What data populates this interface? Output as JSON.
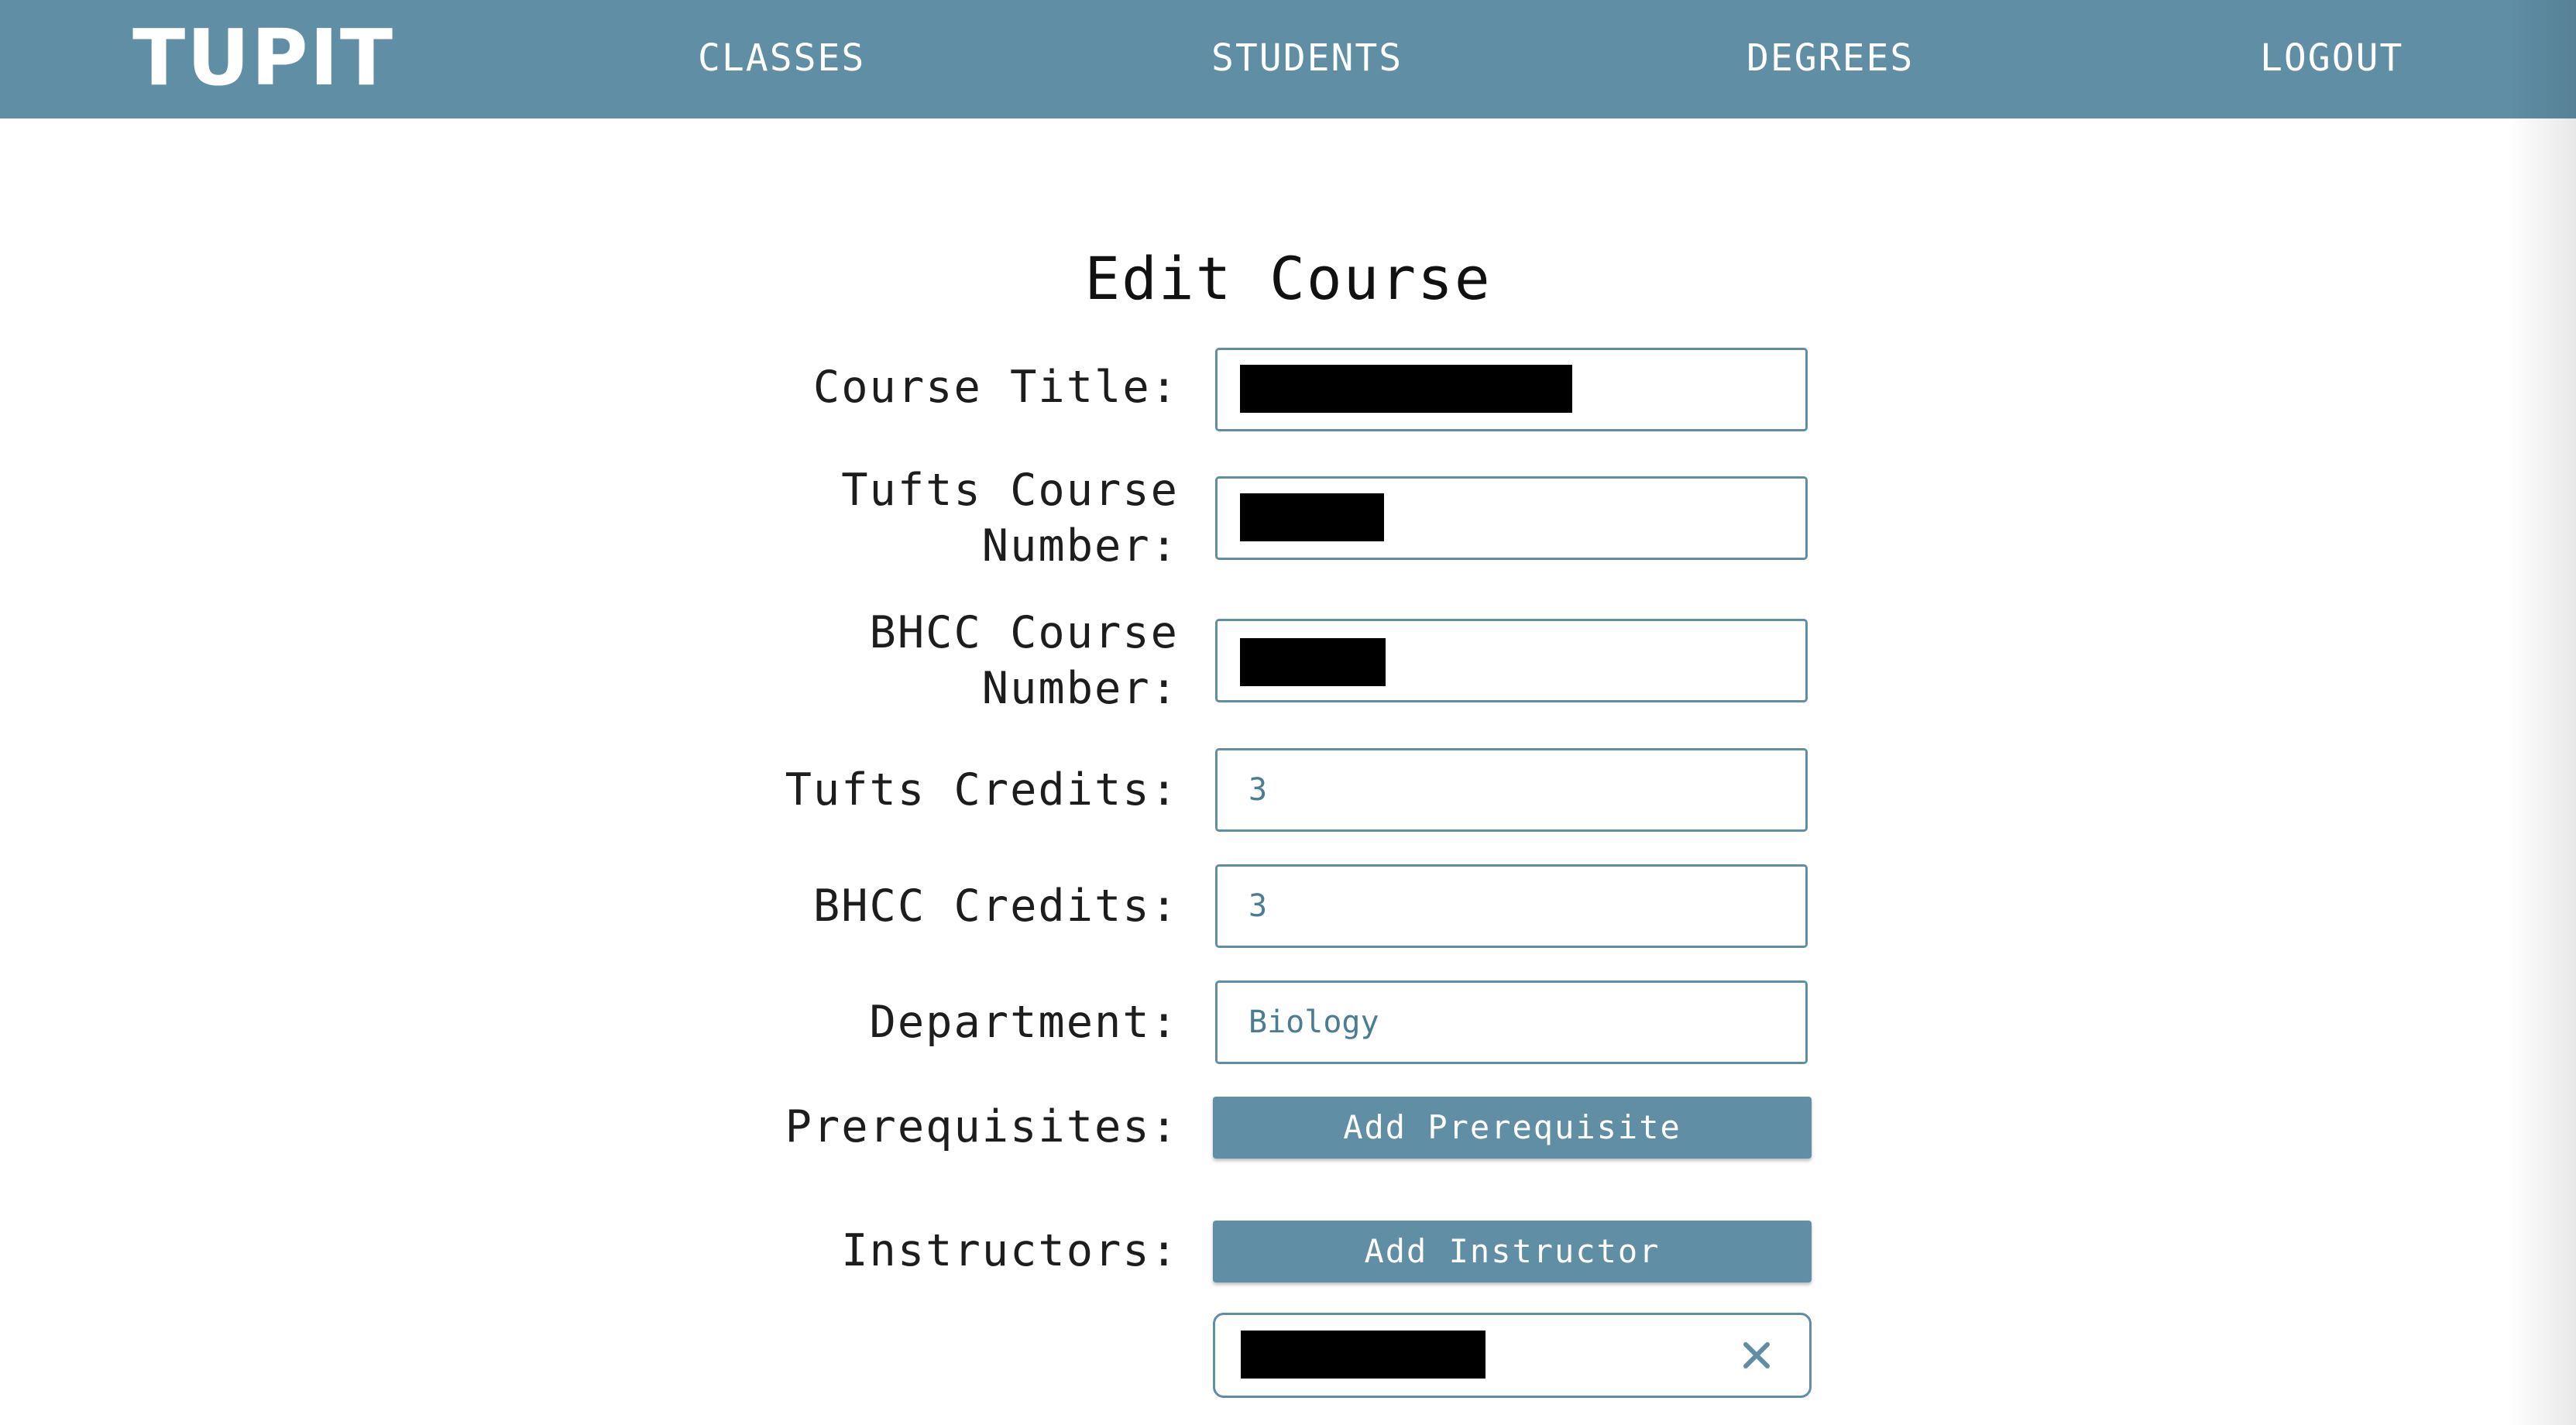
{
  "nav": {
    "logo": "TUPIT",
    "links": [
      "CLASSES",
      "STUDENTS",
      "DEGREES",
      "LOGOUT"
    ]
  },
  "page": {
    "title": "Edit Course"
  },
  "form": {
    "course_title_label": "Course Title:",
    "tufts_course_number_label_line1": "Tufts Course",
    "tufts_course_number_label_line2": "Number:",
    "bhcc_course_number_label_line1": "BHCC Course",
    "bhcc_course_number_label_line2": "Number:",
    "tufts_credits_label": "Tufts Credits:",
    "tufts_credits_value": "3",
    "bhcc_credits_label": "BHCC Credits:",
    "bhcc_credits_value": "3",
    "department_label": "Department:",
    "department_value": "Biology",
    "prerequisites_label": "Prerequisites:",
    "add_prerequisite_label": "Add Prerequisite",
    "instructors_label": "Instructors:",
    "add_instructor_label": "Add Instructor"
  },
  "colors": {
    "primary": "#5f8ea5",
    "input_text": "#4a7c95",
    "redaction": "#000000"
  },
  "icons": {
    "remove_instructor": "close-icon"
  }
}
